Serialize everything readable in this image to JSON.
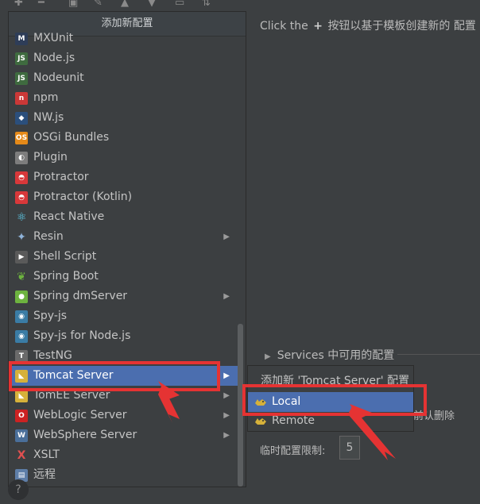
{
  "hint": {
    "pre": "Click the",
    "plus": "+",
    "post": "按钮以基于模板创建新的 配置"
  },
  "popup": {
    "title": "添加新配置",
    "items": [
      {
        "label": "MXUnit",
        "icon": "mxunit-icon",
        "submenu": false
      },
      {
        "label": "Node.js",
        "icon": "nodejs-icon",
        "submenu": false
      },
      {
        "label": "Nodeunit",
        "icon": "nodeunit-icon",
        "submenu": false
      },
      {
        "label": "npm",
        "icon": "npm-icon",
        "submenu": false
      },
      {
        "label": "NW.js",
        "icon": "nwjs-icon",
        "submenu": false
      },
      {
        "label": "OSGi Bundles",
        "icon": "osgi-icon",
        "submenu": false
      },
      {
        "label": "Plugin",
        "icon": "plugin-icon",
        "submenu": false
      },
      {
        "label": "Protractor",
        "icon": "protractor-icon",
        "submenu": false
      },
      {
        "label": "Protractor (Kotlin)",
        "icon": "protractor-icon",
        "submenu": false
      },
      {
        "label": "React Native",
        "icon": "react-icon",
        "submenu": false
      },
      {
        "label": "Resin",
        "icon": "resin-icon",
        "submenu": true
      },
      {
        "label": "Shell Script",
        "icon": "shell-script-icon",
        "submenu": false
      },
      {
        "label": "Spring Boot",
        "icon": "spring-boot-icon",
        "submenu": false
      },
      {
        "label": "Spring dmServer",
        "icon": "spring-dmserver-icon",
        "submenu": true
      },
      {
        "label": "Spy-js",
        "icon": "spy-js-icon",
        "submenu": false
      },
      {
        "label": "Spy-js for Node.js",
        "icon": "spy-js-icon",
        "submenu": false
      },
      {
        "label": "TestNG",
        "icon": "testng-icon",
        "submenu": false
      },
      {
        "label": "Tomcat Server",
        "icon": "tomcat-icon",
        "submenu": true,
        "selected": true
      },
      {
        "label": "TomEE Server",
        "icon": "tomee-icon",
        "submenu": true
      },
      {
        "label": "WebLogic Server",
        "icon": "weblogic-icon",
        "submenu": true
      },
      {
        "label": "WebSphere Server",
        "icon": "websphere-icon",
        "submenu": true
      },
      {
        "label": "XSLT",
        "icon": "xslt-icon",
        "submenu": false
      },
      {
        "label": "远程",
        "icon": "remote-icon",
        "submenu": false
      }
    ]
  },
  "submenu": {
    "title": "添加新 'Tomcat Server' 配置",
    "items": [
      {
        "label": "Local",
        "selected": true
      },
      {
        "label": "Remote",
        "selected": false
      }
    ]
  },
  "services": {
    "label": "Services 中可用的配置"
  },
  "delete_hint": {
    "label": "确认删除",
    "visible_fragment": "前认删除"
  },
  "temp_limit": {
    "label": "临时配置限制:",
    "value": "5"
  },
  "help": {
    "label": "?"
  },
  "colors": {
    "accent": "#4b6eaf",
    "annotation": "#e53333",
    "background": "#3c3f41"
  }
}
